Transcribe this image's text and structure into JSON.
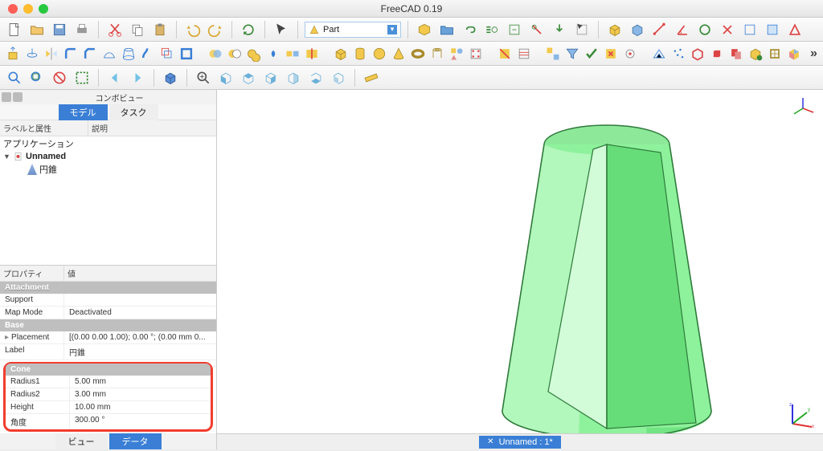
{
  "window": {
    "title": "FreeCAD 0.19"
  },
  "workbench": {
    "selected": "Part"
  },
  "combo_view": {
    "title": "コンボビュー",
    "tabs": {
      "model": "モデル",
      "task": "タスク"
    }
  },
  "tree": {
    "columns": {
      "label": "ラベルと属性",
      "desc": "説明"
    },
    "root": "アプリケーション",
    "doc": "Unnamed",
    "item": "円錐"
  },
  "property": {
    "columns": {
      "prop": "プロパティ",
      "val": "値"
    },
    "attachment_cat": "Attachment",
    "attachment": [
      {
        "name": "Support",
        "value": ""
      },
      {
        "name": "Map Mode",
        "value": "Deactivated"
      }
    ],
    "base_cat": "Base",
    "base": [
      {
        "name": "Placement",
        "value": "[(0.00 0.00 1.00); 0.00 °; (0.00 mm  0..."
      },
      {
        "name": "Label",
        "value": "円錐"
      }
    ],
    "cone_cat": "Cone",
    "cone": [
      {
        "name": "Radius1",
        "value": "5.00 mm"
      },
      {
        "name": "Radius2",
        "value": "3.00 mm"
      },
      {
        "name": "Height",
        "value": "10.00 mm"
      },
      {
        "name": "角度",
        "value": "300.00 °"
      }
    ],
    "bottom_tabs": {
      "view": "ビュー",
      "data": "データ"
    }
  },
  "status": {
    "doc_tab": "Unnamed : 1*"
  }
}
